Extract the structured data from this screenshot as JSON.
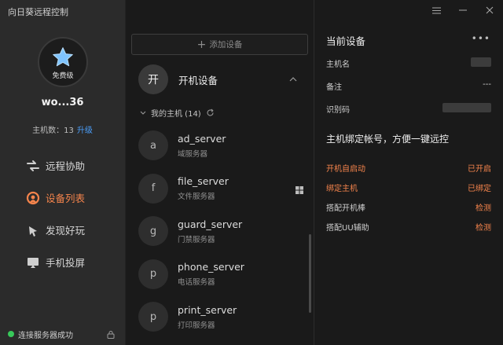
{
  "app": {
    "title": "向日葵远程控制"
  },
  "profile": {
    "level": "免费级",
    "username": "wo...36",
    "host_count_label": "主机数：13",
    "upgrade_label": "升级"
  },
  "nav": {
    "items": [
      {
        "label": "远程协助",
        "icon": "remote-assist-icon"
      },
      {
        "label": "设备列表",
        "icon": "device-list-icon",
        "active": true
      },
      {
        "label": "发现好玩",
        "icon": "discover-icon"
      },
      {
        "label": "手机投屏",
        "icon": "screen-mirror-icon"
      }
    ]
  },
  "status": {
    "text": "连接服务器成功"
  },
  "middle": {
    "add_device_label": "添加设备",
    "group": {
      "avatar": "开",
      "title": "开机设备"
    },
    "subgroup_label": "我的主机 (14)",
    "devices": [
      {
        "initial": "a",
        "name": "ad_server",
        "desc": "域服务器",
        "windows": false
      },
      {
        "initial": "f",
        "name": "file_server",
        "desc": "文件服务器",
        "windows": true
      },
      {
        "initial": "g",
        "name": "guard_server",
        "desc": "门禁服务器",
        "windows": false
      },
      {
        "initial": "p",
        "name": "phone_server",
        "desc": "电话服务器",
        "windows": false
      },
      {
        "initial": "p",
        "name": "print_server",
        "desc": "打印服务器",
        "windows": false
      }
    ]
  },
  "right": {
    "title": "当前设备",
    "rows": [
      {
        "label": "主机名",
        "value": ""
      },
      {
        "label": "备注",
        "value": "---"
      },
      {
        "label": "识别码",
        "value": ""
      }
    ],
    "bind_hint": "主机绑定帐号，方便一键远控",
    "status_rows": [
      {
        "label": "开机自启动",
        "value": "已开启",
        "warn": true
      },
      {
        "label": "绑定主机",
        "value": "已绑定",
        "warn": true
      },
      {
        "label": "搭配开机棒",
        "value": "检测",
        "warn": false
      },
      {
        "label": "搭配UU辅助",
        "value": "检测",
        "warn": false
      }
    ]
  },
  "colors": {
    "accent": "#f5844c",
    "link": "#4a9df8",
    "online": "#38c85a"
  }
}
